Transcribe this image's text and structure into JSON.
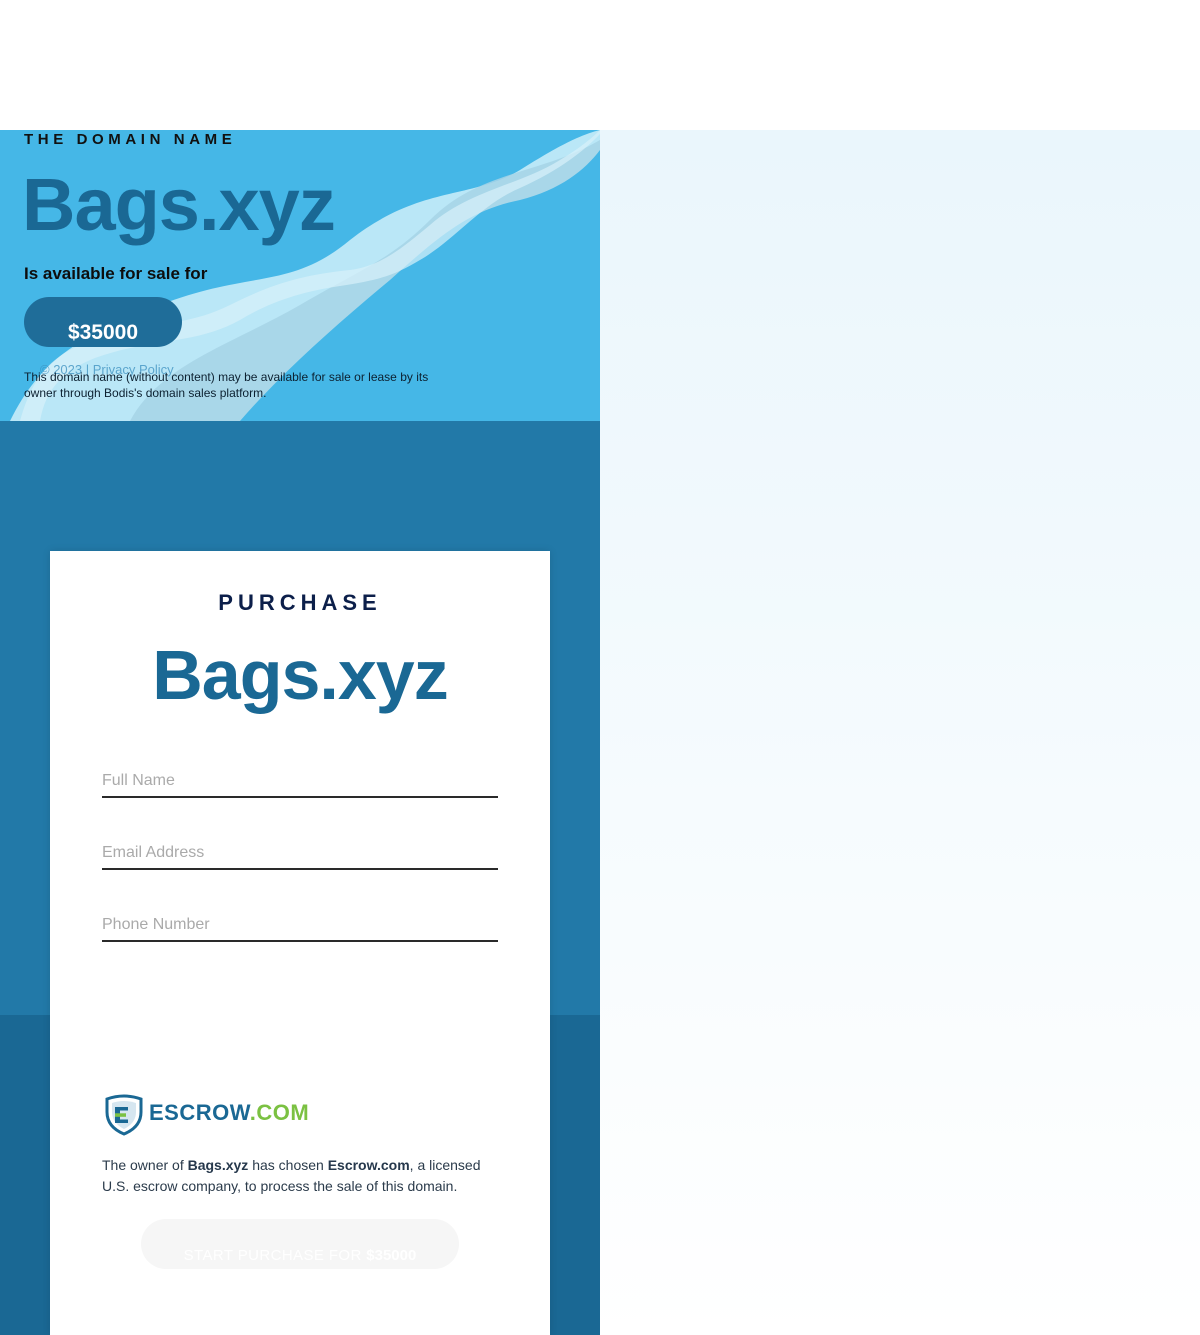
{
  "hero": {
    "eyebrow": "THE DOMAIN NAME",
    "domain": "Bags.xyz",
    "subtitle": "Is available for sale for",
    "price": "$35000",
    "footer": "© 2023 | Privacy Policy",
    "disclaimer": "This domain name (without content) may be available for sale or lease by its owner through Bodis's domain sales platform."
  },
  "purchase": {
    "eyebrow": "PURCHASE",
    "domain": "Bags.xyz",
    "fields": {
      "full_name_placeholder": "Full Name",
      "email_placeholder": "Email Address",
      "phone_placeholder": "Phone Number"
    },
    "escrow": {
      "logo_text_1": "ESCROW",
      "logo_text_2": ".COM",
      "text_1": "The owner of ",
      "domain": "Bags.xyz",
      "text_2": " has chosen ",
      "company": "Escrow.com",
      "text_3": ", a licensed U.S. escrow company, to process the sale of this domain."
    },
    "cta": {
      "label": "START PURCHASE FOR ",
      "amount": "$35000"
    }
  },
  "colors": {
    "hero_bg": "#45b7e7",
    "brand_blue": "#1a6894",
    "mid_band": "#2279a8",
    "escrow_green": "#7bc142"
  }
}
